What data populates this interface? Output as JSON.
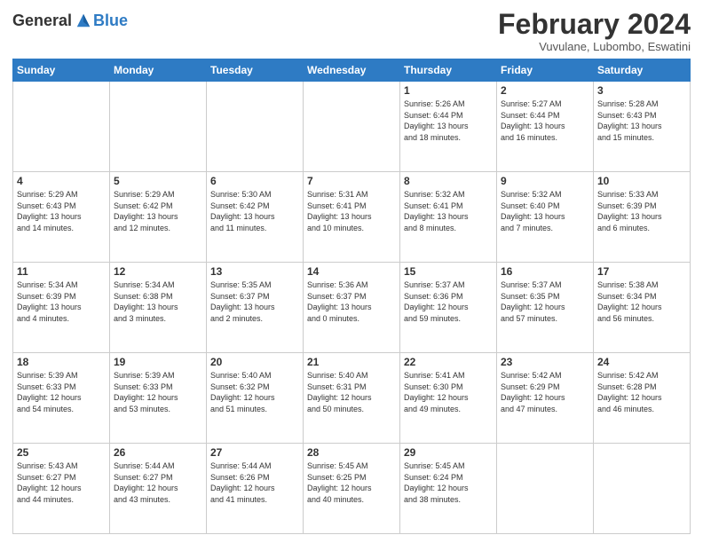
{
  "header": {
    "logo_general": "General",
    "logo_blue": "Blue",
    "title": "February 2024",
    "subtitle": "Vuvulane, Lubombo, Eswatini"
  },
  "weekdays": [
    "Sunday",
    "Monday",
    "Tuesday",
    "Wednesday",
    "Thursday",
    "Friday",
    "Saturday"
  ],
  "weeks": [
    [
      {
        "day": "",
        "info": ""
      },
      {
        "day": "",
        "info": ""
      },
      {
        "day": "",
        "info": ""
      },
      {
        "day": "",
        "info": ""
      },
      {
        "day": "1",
        "info": "Sunrise: 5:26 AM\nSunset: 6:44 PM\nDaylight: 13 hours\nand 18 minutes."
      },
      {
        "day": "2",
        "info": "Sunrise: 5:27 AM\nSunset: 6:44 PM\nDaylight: 13 hours\nand 16 minutes."
      },
      {
        "day": "3",
        "info": "Sunrise: 5:28 AM\nSunset: 6:43 PM\nDaylight: 13 hours\nand 15 minutes."
      }
    ],
    [
      {
        "day": "4",
        "info": "Sunrise: 5:29 AM\nSunset: 6:43 PM\nDaylight: 13 hours\nand 14 minutes."
      },
      {
        "day": "5",
        "info": "Sunrise: 5:29 AM\nSunset: 6:42 PM\nDaylight: 13 hours\nand 12 minutes."
      },
      {
        "day": "6",
        "info": "Sunrise: 5:30 AM\nSunset: 6:42 PM\nDaylight: 13 hours\nand 11 minutes."
      },
      {
        "day": "7",
        "info": "Sunrise: 5:31 AM\nSunset: 6:41 PM\nDaylight: 13 hours\nand 10 minutes."
      },
      {
        "day": "8",
        "info": "Sunrise: 5:32 AM\nSunset: 6:41 PM\nDaylight: 13 hours\nand 8 minutes."
      },
      {
        "day": "9",
        "info": "Sunrise: 5:32 AM\nSunset: 6:40 PM\nDaylight: 13 hours\nand 7 minutes."
      },
      {
        "day": "10",
        "info": "Sunrise: 5:33 AM\nSunset: 6:39 PM\nDaylight: 13 hours\nand 6 minutes."
      }
    ],
    [
      {
        "day": "11",
        "info": "Sunrise: 5:34 AM\nSunset: 6:39 PM\nDaylight: 13 hours\nand 4 minutes."
      },
      {
        "day": "12",
        "info": "Sunrise: 5:34 AM\nSunset: 6:38 PM\nDaylight: 13 hours\nand 3 minutes."
      },
      {
        "day": "13",
        "info": "Sunrise: 5:35 AM\nSunset: 6:37 PM\nDaylight: 13 hours\nand 2 minutes."
      },
      {
        "day": "14",
        "info": "Sunrise: 5:36 AM\nSunset: 6:37 PM\nDaylight: 13 hours\nand 0 minutes."
      },
      {
        "day": "15",
        "info": "Sunrise: 5:37 AM\nSunset: 6:36 PM\nDaylight: 12 hours\nand 59 minutes."
      },
      {
        "day": "16",
        "info": "Sunrise: 5:37 AM\nSunset: 6:35 PM\nDaylight: 12 hours\nand 57 minutes."
      },
      {
        "day": "17",
        "info": "Sunrise: 5:38 AM\nSunset: 6:34 PM\nDaylight: 12 hours\nand 56 minutes."
      }
    ],
    [
      {
        "day": "18",
        "info": "Sunrise: 5:39 AM\nSunset: 6:33 PM\nDaylight: 12 hours\nand 54 minutes."
      },
      {
        "day": "19",
        "info": "Sunrise: 5:39 AM\nSunset: 6:33 PM\nDaylight: 12 hours\nand 53 minutes."
      },
      {
        "day": "20",
        "info": "Sunrise: 5:40 AM\nSunset: 6:32 PM\nDaylight: 12 hours\nand 51 minutes."
      },
      {
        "day": "21",
        "info": "Sunrise: 5:40 AM\nSunset: 6:31 PM\nDaylight: 12 hours\nand 50 minutes."
      },
      {
        "day": "22",
        "info": "Sunrise: 5:41 AM\nSunset: 6:30 PM\nDaylight: 12 hours\nand 49 minutes."
      },
      {
        "day": "23",
        "info": "Sunrise: 5:42 AM\nSunset: 6:29 PM\nDaylight: 12 hours\nand 47 minutes."
      },
      {
        "day": "24",
        "info": "Sunrise: 5:42 AM\nSunset: 6:28 PM\nDaylight: 12 hours\nand 46 minutes."
      }
    ],
    [
      {
        "day": "25",
        "info": "Sunrise: 5:43 AM\nSunset: 6:27 PM\nDaylight: 12 hours\nand 44 minutes."
      },
      {
        "day": "26",
        "info": "Sunrise: 5:44 AM\nSunset: 6:27 PM\nDaylight: 12 hours\nand 43 minutes."
      },
      {
        "day": "27",
        "info": "Sunrise: 5:44 AM\nSunset: 6:26 PM\nDaylight: 12 hours\nand 41 minutes."
      },
      {
        "day": "28",
        "info": "Sunrise: 5:45 AM\nSunset: 6:25 PM\nDaylight: 12 hours\nand 40 minutes."
      },
      {
        "day": "29",
        "info": "Sunrise: 5:45 AM\nSunset: 6:24 PM\nDaylight: 12 hours\nand 38 minutes."
      },
      {
        "day": "",
        "info": ""
      },
      {
        "day": "",
        "info": ""
      }
    ]
  ]
}
